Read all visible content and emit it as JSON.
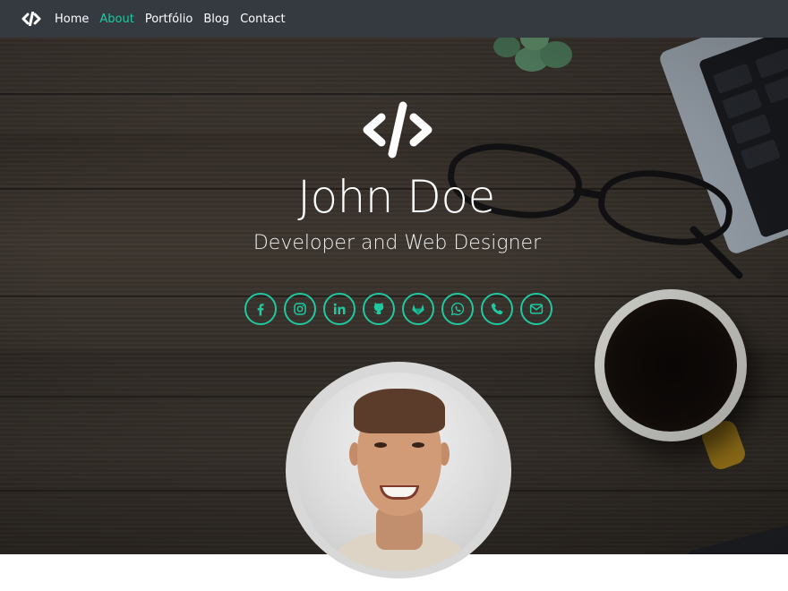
{
  "navbar": {
    "brand_icon": "code-icon",
    "links": [
      {
        "label": "Home",
        "active": false
      },
      {
        "label": "About",
        "active": true
      },
      {
        "label": "Portfólio",
        "active": false
      },
      {
        "label": "Blog",
        "active": false
      },
      {
        "label": "Contact",
        "active": false
      }
    ],
    "active_color": "#1fc8a0",
    "background": "#343a40"
  },
  "hero": {
    "logo_icon": "code-icon",
    "name": "John Doe",
    "subtitle": "Developer and Web Designer",
    "socials": [
      {
        "icon": "facebook-icon"
      },
      {
        "icon": "instagram-icon"
      },
      {
        "icon": "linkedin-icon"
      },
      {
        "icon": "github-icon"
      },
      {
        "icon": "gitlab-icon"
      },
      {
        "icon": "whatsapp-icon"
      },
      {
        "icon": "phone-icon"
      },
      {
        "icon": "email-icon"
      }
    ],
    "accent_color": "#1fc8a0"
  },
  "avatar": {
    "description_icon": "profile-photo"
  }
}
